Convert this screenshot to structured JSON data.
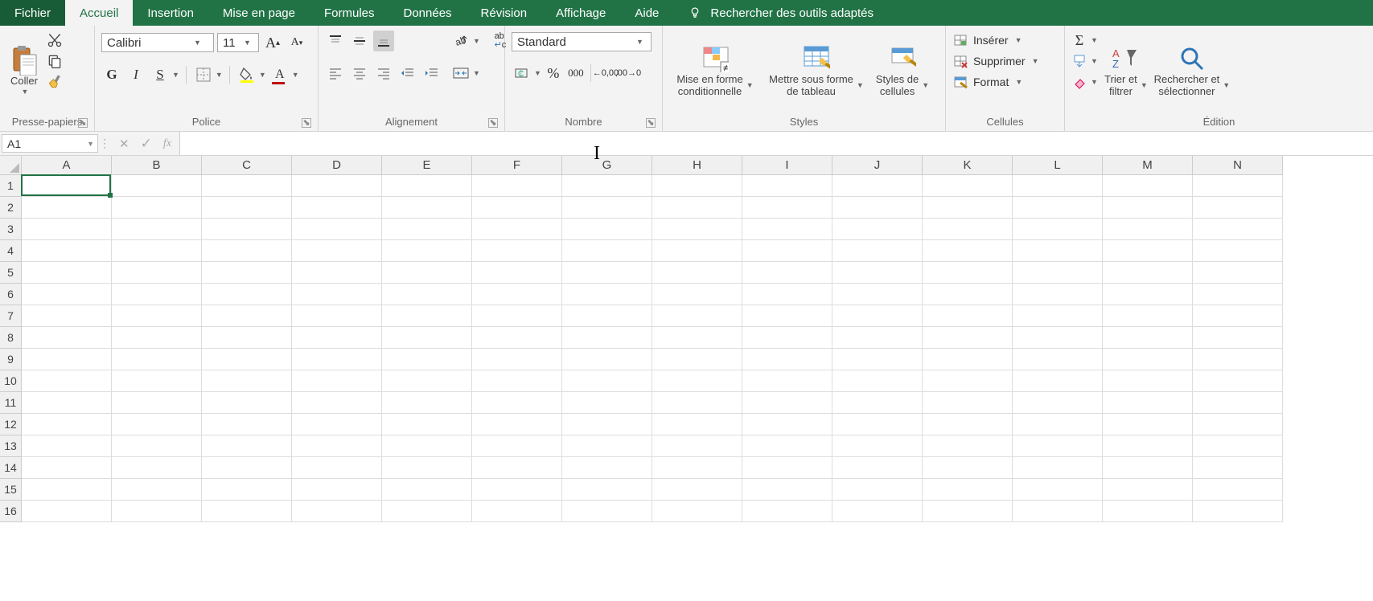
{
  "tabs": {
    "fichier": "Fichier",
    "accueil": "Accueil",
    "insertion": "Insertion",
    "mise_en_page": "Mise en page",
    "formules": "Formules",
    "donnees": "Données",
    "revision": "Révision",
    "affichage": "Affichage",
    "aide": "Aide",
    "search": "Rechercher des outils adaptés"
  },
  "clipboard": {
    "paste": "Coller",
    "group": "Presse-papiers"
  },
  "font": {
    "name": "Calibri",
    "size": "11",
    "bold": "G",
    "italic": "I",
    "underline": "S",
    "group": "Police"
  },
  "alignment": {
    "wrap": "ab\nc",
    "group": "Alignement"
  },
  "number": {
    "format": "Standard",
    "group": "Nombre"
  },
  "styles": {
    "cond": "Mise en forme\nconditionnelle",
    "table": "Mettre sous forme\nde tableau",
    "cell": "Styles de\ncellules",
    "group": "Styles"
  },
  "cells": {
    "insert": "Insérer",
    "delete": "Supprimer",
    "format": "Format",
    "group": "Cellules"
  },
  "editing": {
    "sort": "Trier et\nfiltrer",
    "find": "Rechercher et\nsélectionner",
    "group": "Édition"
  },
  "fbar": {
    "cell_ref": "A1",
    "fx": "fx",
    "formula": ""
  },
  "grid": {
    "cols": [
      "A",
      "B",
      "C",
      "D",
      "E",
      "F",
      "G",
      "H",
      "I",
      "J",
      "K",
      "L",
      "M",
      "N"
    ],
    "rows": [
      "1",
      "2",
      "3",
      "4",
      "5",
      "6",
      "7",
      "8",
      "9",
      "10",
      "11",
      "12",
      "13",
      "14",
      "15",
      "16"
    ],
    "selected": "A1"
  }
}
